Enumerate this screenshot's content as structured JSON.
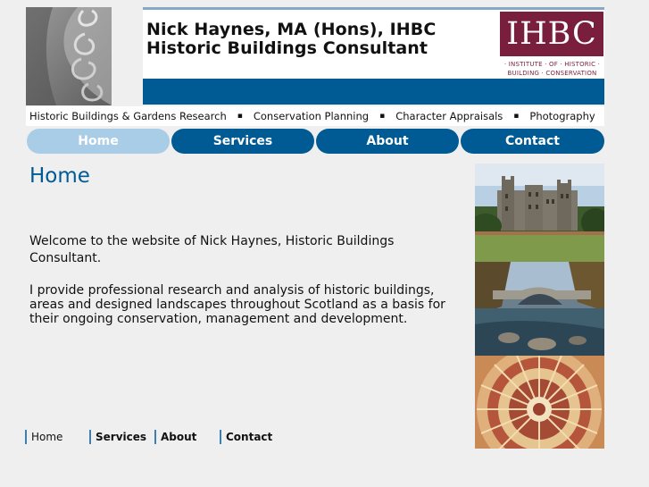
{
  "header": {
    "title_line1": "Nick Haynes, MA (Hons), IHBC",
    "title_line2": "Historic Buildings Consultant",
    "logo": {
      "mark": "IHBC",
      "line1": "· INSTITUTE · OF · HISTORIC ·",
      "line2": "BUILDING · CONSERVATION",
      "color": "#7a1e3d"
    }
  },
  "tagline": {
    "items": [
      "Historic Buildings & Gardens Research",
      "Conservation Planning",
      "Character Appraisals",
      "Photography"
    ],
    "separator": "▪"
  },
  "nav": {
    "items": [
      "Home",
      "Services",
      "About",
      "Contact"
    ],
    "active": "Home"
  },
  "main": {
    "title": "Home",
    "paragraphs": [
      "Welcome to the website of Nick Haynes, Historic Buildings Consultant.",
      "I provide professional research and analysis of historic buildings, areas and designed landscapes throughout Scotland as a basis for their ongoing conservation, management and development."
    ]
  },
  "footer_nav": {
    "items": [
      "Home",
      "Services",
      "About",
      "Contact"
    ]
  },
  "colors": {
    "brand_blue": "#005b94",
    "active_pill": "#a9cde6",
    "background": "#efefef"
  }
}
